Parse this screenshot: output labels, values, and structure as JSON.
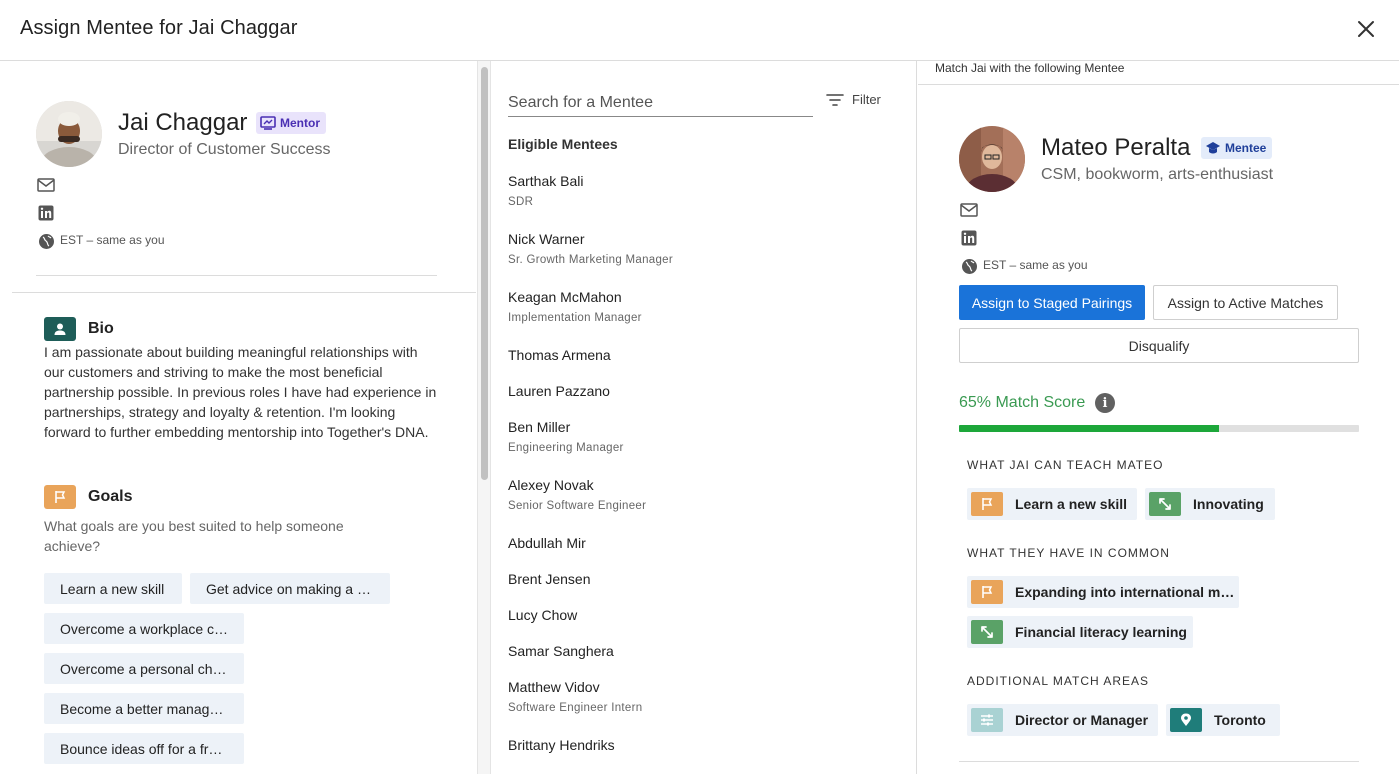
{
  "header": {
    "title": "Assign Mentee for Jai Chaggar"
  },
  "mentor": {
    "name": "Jai Chaggar",
    "badge": "Mentor",
    "title": "Director of Customer Success",
    "timezone": "EST – same as you",
    "bio_title": "Bio",
    "bio": "I am passionate about building meaningful relationships with our customers and striving to make the most beneficial partnership possible. In previous roles I have had experience in partnerships, strategy and loyalty & retention. I'm looking forward to further embedding mentorship into Together's DNA.",
    "goals_title": "Goals",
    "goals_question": "What goals are you best suited to help someone achieve?",
    "goals": [
      "Learn a new skill",
      "Get advice on making a …",
      "Overcome a workplace c…",
      "Overcome a personal ch…",
      "Become a better manag…",
      "Bounce ideas off for a fr…"
    ]
  },
  "search": {
    "placeholder": "Search for a Mentee",
    "filter_label": "Filter"
  },
  "eligible": {
    "title": "Eligible Mentees",
    "mentees": [
      {
        "name": "Sarthak Bali",
        "role": "SDR"
      },
      {
        "name": "Nick Warner",
        "role": "Sr. Growth Marketing Manager"
      },
      {
        "name": "Keagan McMahon",
        "role": "Implementation Manager"
      },
      {
        "name": "Thomas Armena",
        "role": ""
      },
      {
        "name": "Lauren Pazzano",
        "role": ""
      },
      {
        "name": "Ben Miller",
        "role": "Engineering Manager"
      },
      {
        "name": "Alexey Novak",
        "role": "Senior Software Engineer"
      },
      {
        "name": "Abdullah Mir",
        "role": ""
      },
      {
        "name": "Brent Jensen",
        "role": ""
      },
      {
        "name": "Lucy Chow",
        "role": ""
      },
      {
        "name": "Samar Sanghera",
        "role": ""
      },
      {
        "name": "Matthew Vidov",
        "role": "Software Engineer Intern"
      },
      {
        "name": "Brittany Hendriks",
        "role": ""
      }
    ]
  },
  "match": {
    "heading": "Match Jai with the following Mentee",
    "mentee_name": "Mateo Peralta",
    "badge": "Mentee",
    "tagline": "CSM, bookworm, arts-enthusiast",
    "timezone": "EST – same as you",
    "assign_staged": "Assign to Staged Pairings",
    "assign_active": "Assign to Active Matches",
    "disqualify": "Disqualify",
    "score_text": "65% Match Score",
    "score_percent": 65,
    "info_glyph": "i",
    "teach_title": "WHAT JAI CAN TEACH MATEO",
    "teach": [
      {
        "label": "Learn a new skill",
        "icon": "flag-icon"
      },
      {
        "label": "Innovating",
        "icon": "expand-arrows-icon"
      }
    ],
    "common_title": "WHAT THEY HAVE IN COMMON",
    "common": [
      {
        "label": "Expanding into international m…",
        "icon": "flag-icon"
      },
      {
        "label": "Financial literacy learning",
        "icon": "expand-arrows-icon"
      }
    ],
    "additional_title": "ADDITIONAL MATCH AREAS",
    "additional": [
      {
        "label": "Director or Manager",
        "icon": "sliders-icon"
      },
      {
        "label": "Toronto",
        "icon": "location-pin-icon"
      }
    ]
  },
  "colors": {
    "primary": "#1a73d9",
    "score_green": "#3a9a52",
    "progress_green": "#1da73a",
    "goal_orange": "#e9a45a",
    "bio_teal": "#1e5d58"
  }
}
